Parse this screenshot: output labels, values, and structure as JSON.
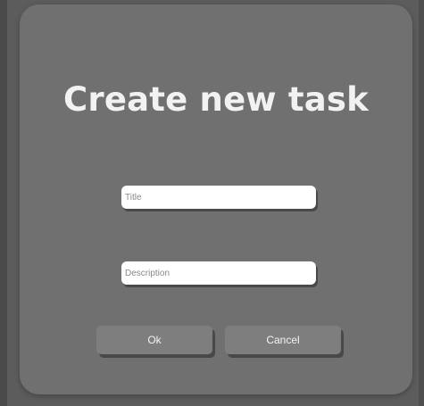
{
  "dialog": {
    "title": "Create new task",
    "fields": {
      "title": {
        "placeholder": "Title",
        "value": ""
      },
      "description": {
        "placeholder": "Description",
        "value": ""
      }
    },
    "buttons": {
      "ok_label": "Ok",
      "cancel_label": "Cancel"
    }
  },
  "colors": {
    "backdrop": "#5c5c5c",
    "dialog_background": "#707070",
    "button_background": "#7e7e7e",
    "title_text": "#f2f2f2",
    "input_background": "#ffffff"
  }
}
